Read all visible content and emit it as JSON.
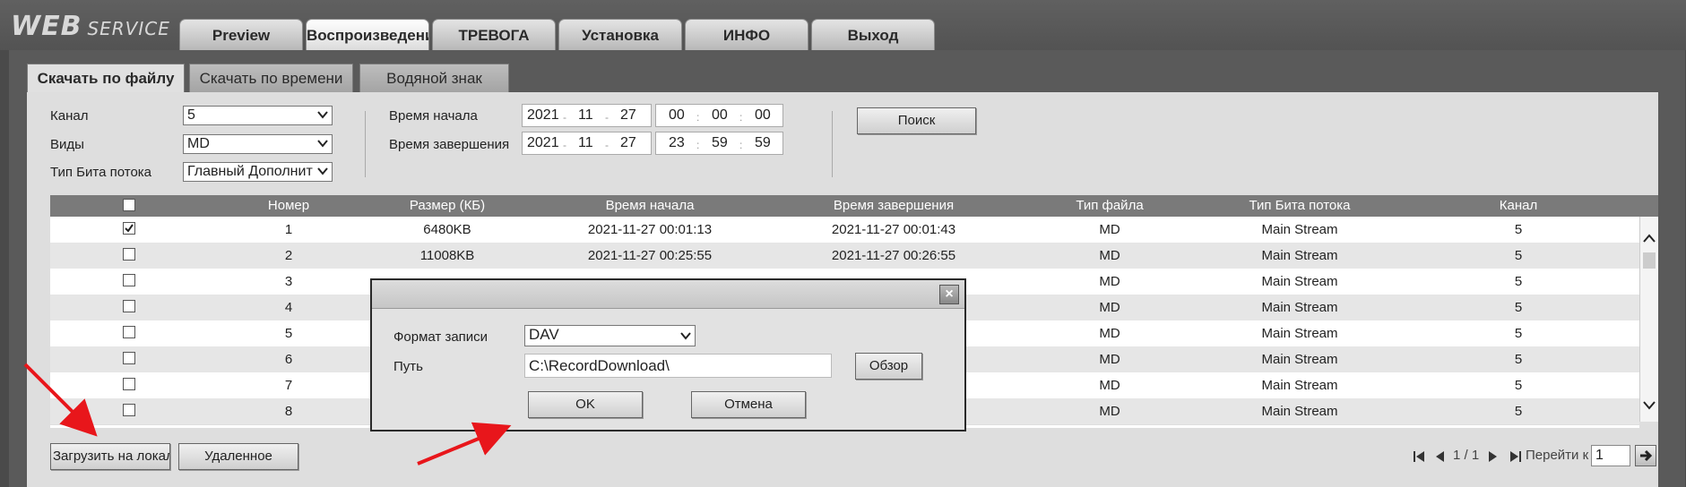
{
  "header": {
    "logo_big": "WEB",
    "logo_small": "SERVICE",
    "tabs": [
      "Preview",
      "Воспроизведени",
      "ТРЕВОГА",
      "Установка",
      "ИНФО",
      "Выход"
    ]
  },
  "subtabs": [
    "Скачать по файлу",
    "Скачать по времени",
    "Водяной знак"
  ],
  "filters": {
    "channel_label": "Канал",
    "channel_value": "5",
    "type_label": "Виды",
    "type_value": "MD",
    "stream_label": "Тип Бита потока",
    "stream_value": "Главный Дополнит",
    "start_label": "Время начала",
    "end_label": "Время завершения",
    "start": {
      "year": "2021",
      "month": "11",
      "day": "27",
      "h": "00",
      "m": "00",
      "s": "00"
    },
    "end": {
      "year": "2021",
      "month": "11",
      "day": "27",
      "h": "23",
      "m": "59",
      "s": "59"
    },
    "search_button": "Поиск"
  },
  "table": {
    "headers": [
      "Номер",
      "Размер (КБ)",
      "Время начала",
      "Время завершения",
      "Тип файла",
      "Тип Бита потока",
      "Канал"
    ],
    "rows": [
      {
        "checked": true,
        "num": "1",
        "size": "6480KB",
        "start": "2021-11-27 00:01:13",
        "end": "2021-11-27 00:01:43",
        "ftype": "MD",
        "stream": "Main Stream",
        "ch": "5"
      },
      {
        "checked": false,
        "num": "2",
        "size": "11008KB",
        "start": "2021-11-27 00:25:55",
        "end": "2021-11-27 00:26:55",
        "ftype": "MD",
        "stream": "Main Stream",
        "ch": "5"
      },
      {
        "checked": false,
        "num": "3",
        "size": "",
        "start": "",
        "end": "",
        "ftype": "MD",
        "stream": "Main Stream",
        "ch": "5"
      },
      {
        "checked": false,
        "num": "4",
        "size": "",
        "start": "",
        "end": "",
        "ftype": "MD",
        "stream": "Main Stream",
        "ch": "5"
      },
      {
        "checked": false,
        "num": "5",
        "size": "",
        "start": "",
        "end": "",
        "ftype": "MD",
        "stream": "Main Stream",
        "ch": "5"
      },
      {
        "checked": false,
        "num": "6",
        "size": "",
        "start": "",
        "end": "",
        "ftype": "MD",
        "stream": "Main Stream",
        "ch": "5"
      },
      {
        "checked": false,
        "num": "7",
        "size": "",
        "start": "",
        "end": "",
        "ftype": "MD",
        "stream": "Main Stream",
        "ch": "5"
      },
      {
        "checked": false,
        "num": "8",
        "size": "",
        "start": "",
        "end": "",
        "ftype": "MD",
        "stream": "Main Stream",
        "ch": "5"
      }
    ]
  },
  "bottom": {
    "download_local": "Загрузить на локаль",
    "remote": "Удаленное",
    "page_info": "1 / 1",
    "goto_label": "Перейти к",
    "goto_value": "1"
  },
  "dialog": {
    "format_label": "Формат записи",
    "format_value": "DAV",
    "path_label": "Путь",
    "path_value": "C:\\RecordDownload\\",
    "browse": "Обзор",
    "ok": "OK",
    "cancel": "Отмена"
  },
  "colors": {
    "annotation_arrow": "#e8161b"
  }
}
